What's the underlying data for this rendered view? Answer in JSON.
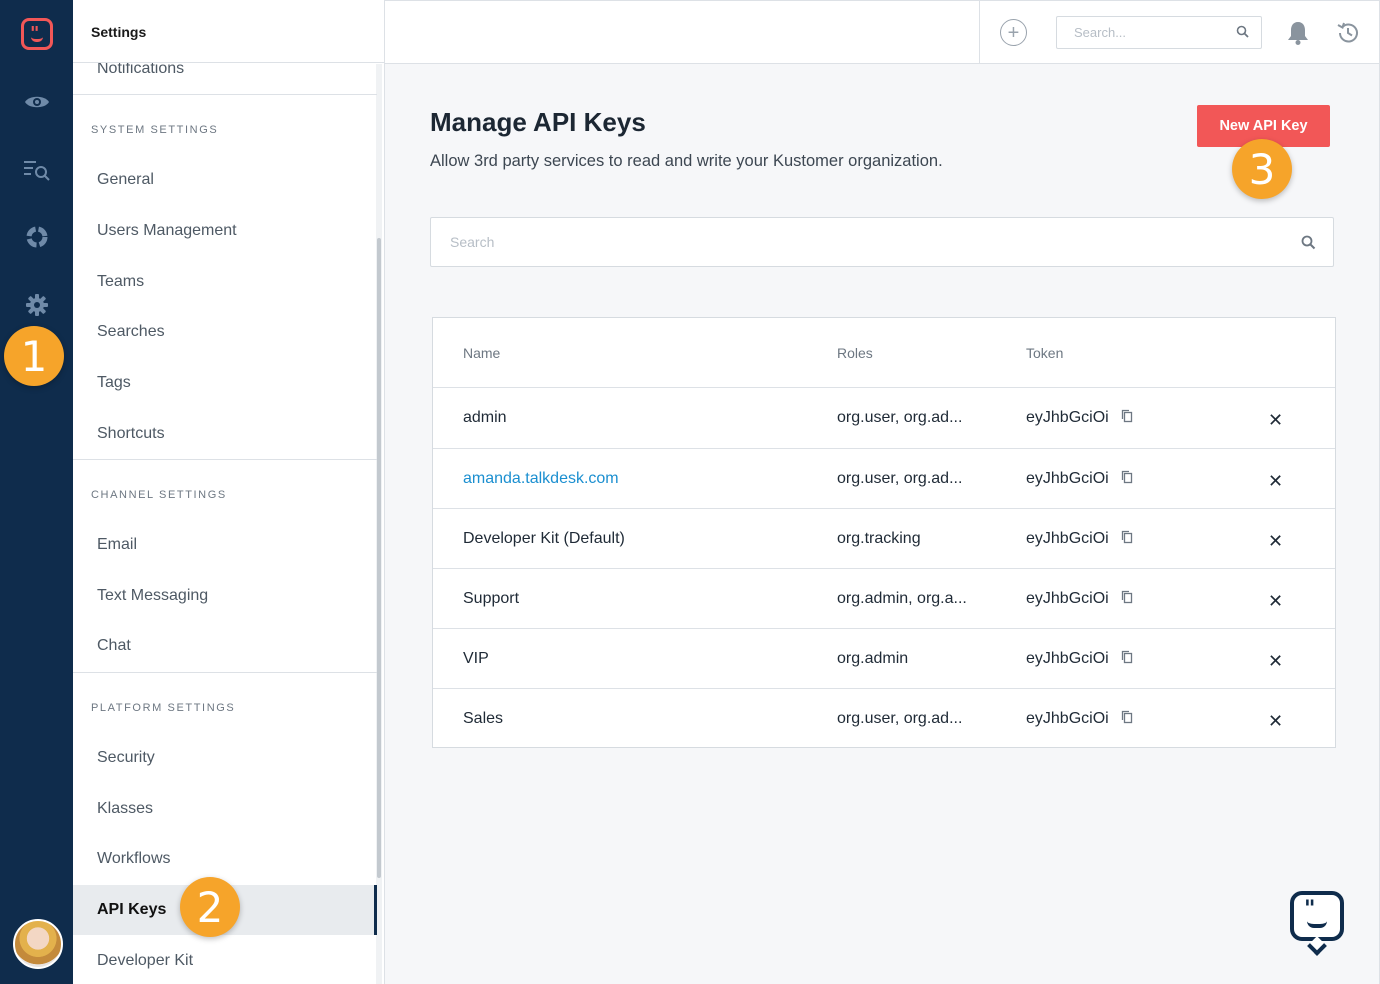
{
  "rail": {
    "icons": [
      "logo-icon",
      "eye-icon",
      "search-list-icon",
      "reports-icon",
      "gear-icon"
    ],
    "markers": [
      "1",
      "2",
      "3"
    ]
  },
  "sidebar": {
    "title": "Settings",
    "top_item": "Notifications",
    "sections": [
      {
        "label": "SYSTEM SETTINGS",
        "items": [
          "General",
          "Users Management",
          "Teams",
          "Searches",
          "Tags",
          "Shortcuts"
        ]
      },
      {
        "label": "CHANNEL SETTINGS",
        "items": [
          "Email",
          "Text Messaging",
          "Chat"
        ]
      },
      {
        "label": "PLATFORM SETTINGS",
        "items": [
          "Security",
          "Klasses",
          "Workflows",
          "API Keys",
          "Developer Kit"
        ]
      }
    ],
    "active_item": "API Keys"
  },
  "topbar": {
    "search_placeholder": "Search..."
  },
  "main": {
    "title": "Manage API Keys",
    "subtitle": "Allow 3rd party services to read and write your Kustomer organization.",
    "new_button": "New API Key",
    "search_placeholder": "Search",
    "table": {
      "headers": [
        "Name",
        "Roles",
        "Token"
      ],
      "rows": [
        {
          "name": "admin",
          "roles": "org.user, org.ad...",
          "token": "eyJhbGciOi",
          "link": false
        },
        {
          "name": "amanda.talkdesk.com",
          "roles": "org.user, org.ad...",
          "token": "eyJhbGciOi",
          "link": true
        },
        {
          "name": "Developer Kit (Default)",
          "roles": "org.tracking",
          "token": "eyJhbGciOi",
          "link": false
        },
        {
          "name": "Support",
          "roles": "org.admin, org.a...",
          "token": "eyJhbGciOi",
          "link": false
        },
        {
          "name": "VIP",
          "roles": "org.admin",
          "token": "eyJhbGciOi",
          "link": false
        },
        {
          "name": "Sales",
          "roles": "org.user, org.ad...",
          "token": "eyJhbGciOi",
          "link": false
        }
      ],
      "delete_symbol": "✕"
    }
  },
  "colors": {
    "rail": "#0f2c4c",
    "accent": "#f25757",
    "marker": "#f6a42a",
    "link": "#1b8fd0"
  }
}
